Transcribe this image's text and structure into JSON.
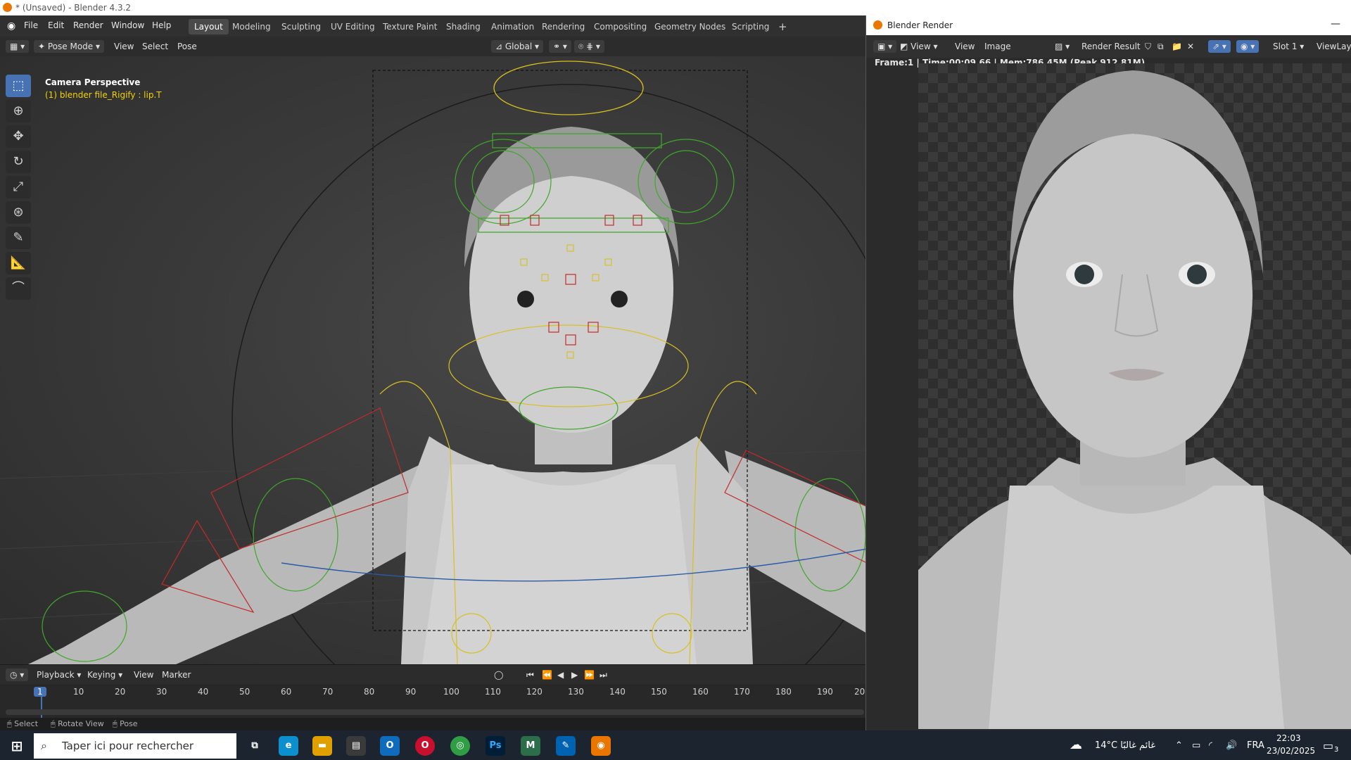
{
  "window": {
    "title": "* (Unsaved) - Blender 4.3.2"
  },
  "menubar": {
    "items": [
      "File",
      "Edit",
      "Render",
      "Window",
      "Help"
    ]
  },
  "workspaces": {
    "tabs": [
      "Layout",
      "Modeling",
      "Sculpting",
      "UV Editing",
      "Texture Paint",
      "Shading",
      "Animation",
      "Rendering",
      "Compositing",
      "Geometry Nodes",
      "Scripting",
      "+"
    ],
    "active": "Layout"
  },
  "viewport_header": {
    "mode": "Pose Mode",
    "view": "View",
    "select": "Select",
    "pose": "Pose",
    "orientation": "Global"
  },
  "viewport": {
    "overlay_title": "Camera Perspective",
    "overlay_info": "(1) blender file_Rigify : lip.T"
  },
  "tools": [
    "select-box",
    "cursor",
    "move",
    "rotate",
    "scale",
    "transform",
    "annotate",
    "measure",
    "relax"
  ],
  "timeline": {
    "playback": "Playback",
    "keying": "Keying",
    "view": "View",
    "marker": "Marker",
    "current_frame": "1",
    "frames": [
      "10",
      "20",
      "30",
      "40",
      "50",
      "60",
      "70",
      "80",
      "90",
      "100",
      "110",
      "120",
      "130",
      "140",
      "150",
      "160",
      "170",
      "180",
      "190",
      "20"
    ]
  },
  "statusbar": {
    "select": "Select",
    "rotate": "Rotate View",
    "pose": "Pose"
  },
  "render_window": {
    "title": "Blender Render",
    "view1": "View",
    "view2": "View",
    "image": "Image",
    "result": "Render Result",
    "slot": "Slot 1",
    "layer": "ViewLaye",
    "info": "Frame:1 | Time:00:09.66 | Mem:786.45M (Peak 912.81M)"
  },
  "taskbar": {
    "search_placeholder": "Taper ici pour rechercher",
    "weather": "14°C  غائم غالبًا",
    "lang": "FRA",
    "time": "22:03",
    "date": "23/02/2025",
    "notif": "3"
  }
}
